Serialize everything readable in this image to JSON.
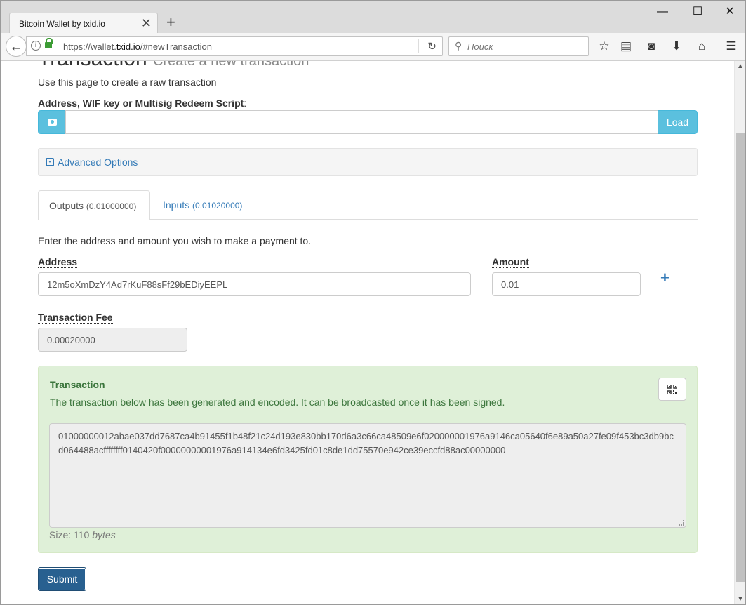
{
  "browser": {
    "tab_title": "Bitcoin Wallet by txid.io",
    "tab_close": "✕",
    "new_tab": "+",
    "url_prefix": "https://wallet.",
    "url_domain": "txid.io",
    "url_suffix": "/#newTransaction",
    "search_placeholder": "Поиск",
    "window_controls": [
      "—",
      "☐",
      "✕"
    ]
  },
  "page": {
    "heading": "Transaction",
    "heading_sub": "Create a new transaction",
    "intro": "Use this page to create a raw transaction",
    "address_label": "Address, WIF key or Multisig Redeem Script",
    "address_label_colon": ":",
    "load_button": "Load",
    "advanced_options": "Advanced Options",
    "tabs": {
      "outputs_label": "Outputs",
      "outputs_amount": "(0.01000000)",
      "inputs_label": "Inputs",
      "inputs_amount": "(0.01020000)"
    },
    "outputs_desc": "Enter the address and amount you wish to make a payment to.",
    "output_address_label": "Address",
    "output_address_value": "12m5oXmDzY4Ad7rKuF88sFf29bEDiyEEPL",
    "amount_label": "Amount",
    "amount_value": "0.01",
    "fee_label": "Transaction Fee",
    "fee_value": "0.00020000",
    "transaction": {
      "title": "Transaction",
      "message": "The transaction below has been generated and encoded. It can be broadcasted once it has been signed.",
      "hex": "01000000012abae037dd7687ca4b91455f1b48f21c24d193e830bb170d6a3c66ca48509e6f020000001976a9146ca05640f6e89a50a27fe09f453bc3db9bcd064488acffffffff0140420f00000000001976a914134e6fd3425fd01c8de1dd75570e942ce39eccfd88ac00000000",
      "size_label": "Size:",
      "size_value": "110",
      "size_unit": "bytes"
    },
    "submit_button": "Submit"
  },
  "colors": {
    "info": "#5bc0de",
    "primary": "#286090",
    "link": "#337ab7",
    "success_bg": "#dff0d8",
    "success_text": "#3c763d"
  }
}
